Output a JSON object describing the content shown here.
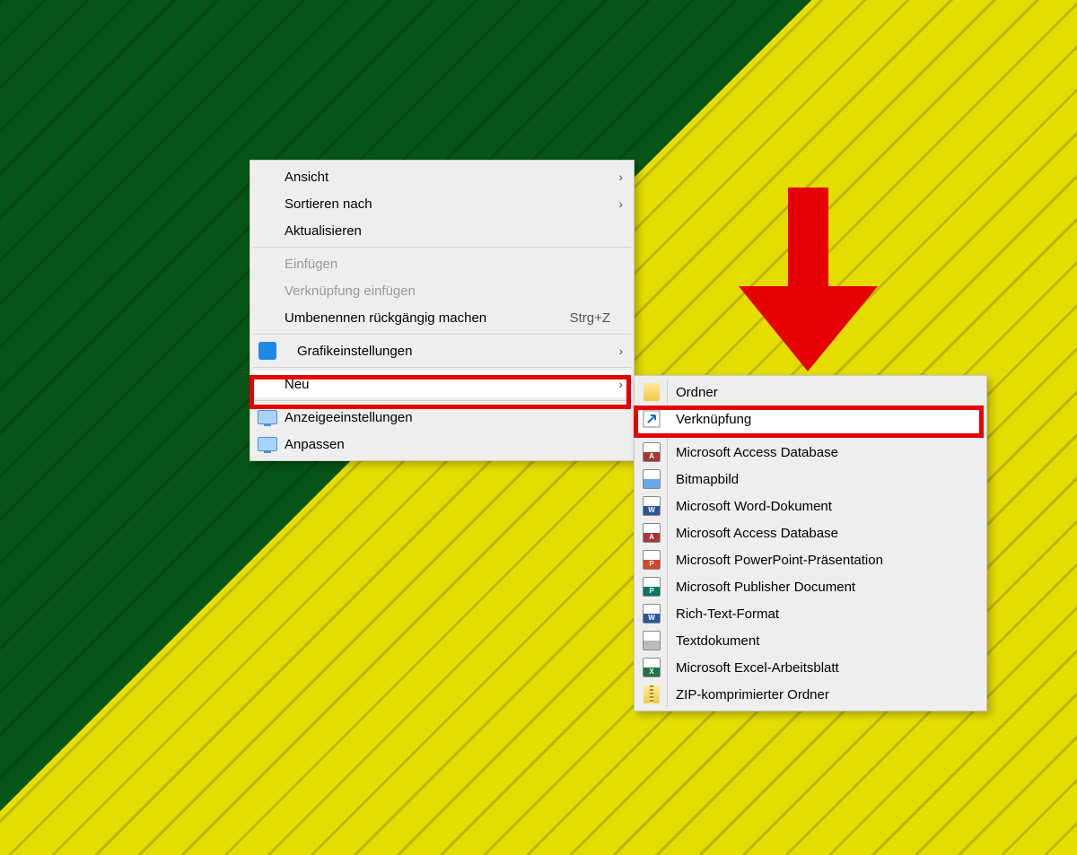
{
  "context_menu": {
    "items": [
      {
        "key": "view",
        "label": "Ansicht",
        "type": "submenu"
      },
      {
        "key": "sort",
        "label": "Sortieren nach",
        "type": "submenu"
      },
      {
        "key": "refresh",
        "label": "Aktualisieren",
        "type": "action"
      },
      {
        "key": "sep1",
        "type": "sep"
      },
      {
        "key": "paste",
        "label": "Einfügen",
        "type": "action",
        "disabled": true
      },
      {
        "key": "paste_shortcut",
        "label": "Verknüpfung einfügen",
        "type": "action",
        "disabled": true
      },
      {
        "key": "undo_rename",
        "label": "Umbenennen rückgängig machen",
        "shortcut": "Strg+Z",
        "type": "action"
      },
      {
        "key": "sep2",
        "type": "sep"
      },
      {
        "key": "graphics",
        "label": "Grafikeinstellungen",
        "type": "submenu",
        "icon": "intel"
      },
      {
        "key": "sep3",
        "type": "sep"
      },
      {
        "key": "new",
        "label": "Neu",
        "type": "submenu",
        "highlighted": true
      },
      {
        "key": "sep4",
        "type": "sep"
      },
      {
        "key": "display",
        "label": "Anzeigeeinstellungen",
        "type": "action",
        "icon": "monitor"
      },
      {
        "key": "personalize",
        "label": "Anpassen",
        "type": "action",
        "icon": "monitor"
      }
    ]
  },
  "new_submenu": {
    "items": [
      {
        "key": "folder",
        "label": "Ordner",
        "icon": "folder"
      },
      {
        "key": "shortcut",
        "label": "Verknüpfung",
        "icon": "shortcut",
        "highlighted": true
      },
      {
        "key": "sep",
        "type": "sep"
      },
      {
        "key": "access1",
        "label": "Microsoft Access Database",
        "icon": "access"
      },
      {
        "key": "bitmap",
        "label": "Bitmapbild",
        "icon": "bitmap"
      },
      {
        "key": "word",
        "label": "Microsoft Word-Dokument",
        "icon": "word"
      },
      {
        "key": "access2",
        "label": "Microsoft Access Database",
        "icon": "access"
      },
      {
        "key": "ppt",
        "label": "Microsoft PowerPoint-Präsentation",
        "icon": "ppt"
      },
      {
        "key": "publisher",
        "label": "Microsoft Publisher Document",
        "icon": "publisher"
      },
      {
        "key": "rtf",
        "label": "Rich-Text-Format",
        "icon": "word"
      },
      {
        "key": "txt",
        "label": "Textdokument",
        "icon": "txt"
      },
      {
        "key": "excel",
        "label": "Microsoft Excel-Arbeitsblatt",
        "icon": "excel"
      },
      {
        "key": "zip",
        "label": "ZIP-komprimierter Ordner",
        "icon": "zip"
      }
    ]
  },
  "annotation": {
    "arrow_color": "#e60000"
  }
}
